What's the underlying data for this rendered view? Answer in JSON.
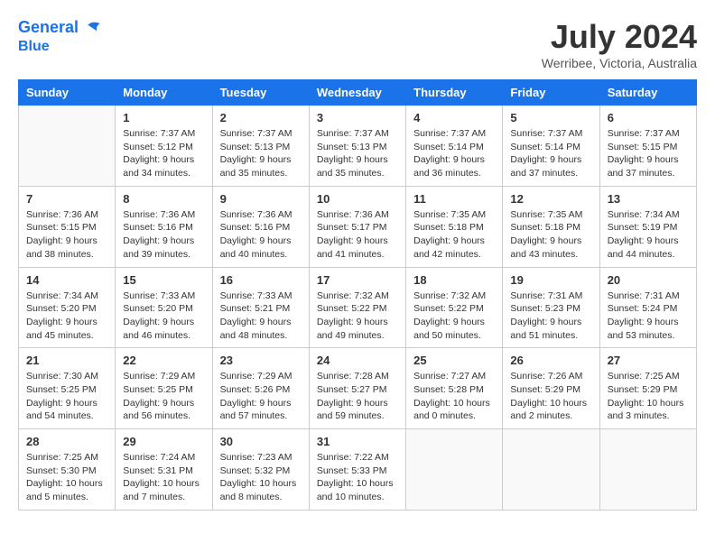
{
  "header": {
    "logo_line1": "General",
    "logo_line2": "Blue",
    "month": "July 2024",
    "location": "Werribee, Victoria, Australia"
  },
  "days_of_week": [
    "Sunday",
    "Monday",
    "Tuesday",
    "Wednesday",
    "Thursday",
    "Friday",
    "Saturday"
  ],
  "weeks": [
    [
      {
        "day": "",
        "info": []
      },
      {
        "day": "1",
        "info": [
          "Sunrise: 7:37 AM",
          "Sunset: 5:12 PM",
          "Daylight: 9 hours",
          "and 34 minutes."
        ]
      },
      {
        "day": "2",
        "info": [
          "Sunrise: 7:37 AM",
          "Sunset: 5:13 PM",
          "Daylight: 9 hours",
          "and 35 minutes."
        ]
      },
      {
        "day": "3",
        "info": [
          "Sunrise: 7:37 AM",
          "Sunset: 5:13 PM",
          "Daylight: 9 hours",
          "and 35 minutes."
        ]
      },
      {
        "day": "4",
        "info": [
          "Sunrise: 7:37 AM",
          "Sunset: 5:14 PM",
          "Daylight: 9 hours",
          "and 36 minutes."
        ]
      },
      {
        "day": "5",
        "info": [
          "Sunrise: 7:37 AM",
          "Sunset: 5:14 PM",
          "Daylight: 9 hours",
          "and 37 minutes."
        ]
      },
      {
        "day": "6",
        "info": [
          "Sunrise: 7:37 AM",
          "Sunset: 5:15 PM",
          "Daylight: 9 hours",
          "and 37 minutes."
        ]
      }
    ],
    [
      {
        "day": "7",
        "info": [
          "Sunrise: 7:36 AM",
          "Sunset: 5:15 PM",
          "Daylight: 9 hours",
          "and 38 minutes."
        ]
      },
      {
        "day": "8",
        "info": [
          "Sunrise: 7:36 AM",
          "Sunset: 5:16 PM",
          "Daylight: 9 hours",
          "and 39 minutes."
        ]
      },
      {
        "day": "9",
        "info": [
          "Sunrise: 7:36 AM",
          "Sunset: 5:16 PM",
          "Daylight: 9 hours",
          "and 40 minutes."
        ]
      },
      {
        "day": "10",
        "info": [
          "Sunrise: 7:36 AM",
          "Sunset: 5:17 PM",
          "Daylight: 9 hours",
          "and 41 minutes."
        ]
      },
      {
        "day": "11",
        "info": [
          "Sunrise: 7:35 AM",
          "Sunset: 5:18 PM",
          "Daylight: 9 hours",
          "and 42 minutes."
        ]
      },
      {
        "day": "12",
        "info": [
          "Sunrise: 7:35 AM",
          "Sunset: 5:18 PM",
          "Daylight: 9 hours",
          "and 43 minutes."
        ]
      },
      {
        "day": "13",
        "info": [
          "Sunrise: 7:34 AM",
          "Sunset: 5:19 PM",
          "Daylight: 9 hours",
          "and 44 minutes."
        ]
      }
    ],
    [
      {
        "day": "14",
        "info": [
          "Sunrise: 7:34 AM",
          "Sunset: 5:20 PM",
          "Daylight: 9 hours",
          "and 45 minutes."
        ]
      },
      {
        "day": "15",
        "info": [
          "Sunrise: 7:33 AM",
          "Sunset: 5:20 PM",
          "Daylight: 9 hours",
          "and 46 minutes."
        ]
      },
      {
        "day": "16",
        "info": [
          "Sunrise: 7:33 AM",
          "Sunset: 5:21 PM",
          "Daylight: 9 hours",
          "and 48 minutes."
        ]
      },
      {
        "day": "17",
        "info": [
          "Sunrise: 7:32 AM",
          "Sunset: 5:22 PM",
          "Daylight: 9 hours",
          "and 49 minutes."
        ]
      },
      {
        "day": "18",
        "info": [
          "Sunrise: 7:32 AM",
          "Sunset: 5:22 PM",
          "Daylight: 9 hours",
          "and 50 minutes."
        ]
      },
      {
        "day": "19",
        "info": [
          "Sunrise: 7:31 AM",
          "Sunset: 5:23 PM",
          "Daylight: 9 hours",
          "and 51 minutes."
        ]
      },
      {
        "day": "20",
        "info": [
          "Sunrise: 7:31 AM",
          "Sunset: 5:24 PM",
          "Daylight: 9 hours",
          "and 53 minutes."
        ]
      }
    ],
    [
      {
        "day": "21",
        "info": [
          "Sunrise: 7:30 AM",
          "Sunset: 5:25 PM",
          "Daylight: 9 hours",
          "and 54 minutes."
        ]
      },
      {
        "day": "22",
        "info": [
          "Sunrise: 7:29 AM",
          "Sunset: 5:25 PM",
          "Daylight: 9 hours",
          "and 56 minutes."
        ]
      },
      {
        "day": "23",
        "info": [
          "Sunrise: 7:29 AM",
          "Sunset: 5:26 PM",
          "Daylight: 9 hours",
          "and 57 minutes."
        ]
      },
      {
        "day": "24",
        "info": [
          "Sunrise: 7:28 AM",
          "Sunset: 5:27 PM",
          "Daylight: 9 hours",
          "and 59 minutes."
        ]
      },
      {
        "day": "25",
        "info": [
          "Sunrise: 7:27 AM",
          "Sunset: 5:28 PM",
          "Daylight: 10 hours",
          "and 0 minutes."
        ]
      },
      {
        "day": "26",
        "info": [
          "Sunrise: 7:26 AM",
          "Sunset: 5:29 PM",
          "Daylight: 10 hours",
          "and 2 minutes."
        ]
      },
      {
        "day": "27",
        "info": [
          "Sunrise: 7:25 AM",
          "Sunset: 5:29 PM",
          "Daylight: 10 hours",
          "and 3 minutes."
        ]
      }
    ],
    [
      {
        "day": "28",
        "info": [
          "Sunrise: 7:25 AM",
          "Sunset: 5:30 PM",
          "Daylight: 10 hours",
          "and 5 minutes."
        ]
      },
      {
        "day": "29",
        "info": [
          "Sunrise: 7:24 AM",
          "Sunset: 5:31 PM",
          "Daylight: 10 hours",
          "and 7 minutes."
        ]
      },
      {
        "day": "30",
        "info": [
          "Sunrise: 7:23 AM",
          "Sunset: 5:32 PM",
          "Daylight: 10 hours",
          "and 8 minutes."
        ]
      },
      {
        "day": "31",
        "info": [
          "Sunrise: 7:22 AM",
          "Sunset: 5:33 PM",
          "Daylight: 10 hours",
          "and 10 minutes."
        ]
      },
      {
        "day": "",
        "info": []
      },
      {
        "day": "",
        "info": []
      },
      {
        "day": "",
        "info": []
      }
    ]
  ]
}
